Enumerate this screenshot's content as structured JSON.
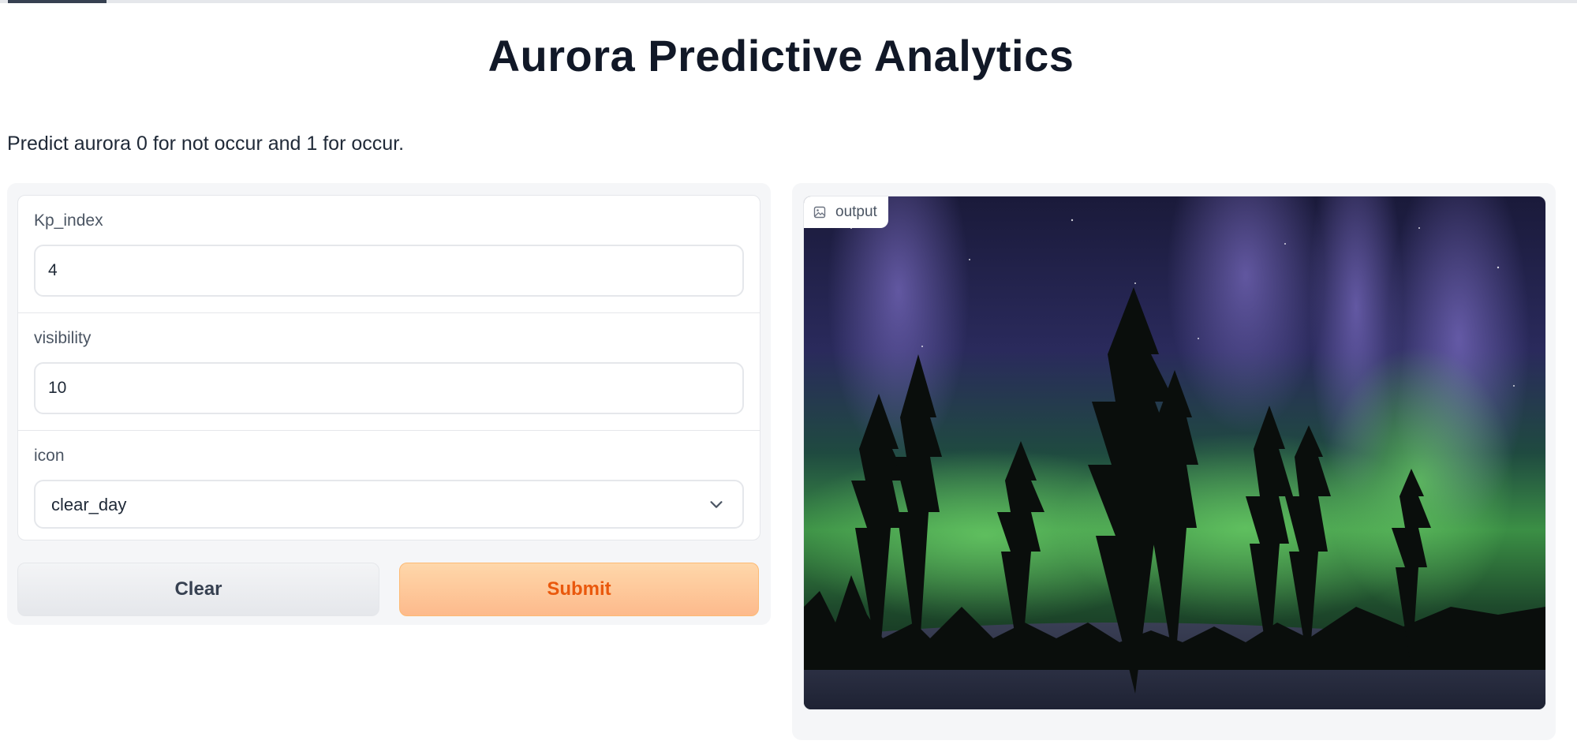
{
  "app": {
    "title": "Aurora Predictive Analytics",
    "description": "Predict aurora 0 for not occur and 1 for occur."
  },
  "inputs": {
    "kp_index": {
      "label": "Kp_index",
      "value": "4"
    },
    "visibility": {
      "label": "visibility",
      "value": "10"
    },
    "icon": {
      "label": "icon",
      "selected": "clear_day"
    }
  },
  "buttons": {
    "clear_label": "Clear",
    "submit_label": "Submit"
  },
  "output": {
    "label": "output",
    "image_icon": "image-icon",
    "image_subject": "aurora-borealis-over-forest"
  },
  "colors": {
    "accent": "#ea580c",
    "submit_bg": "#fdba8c",
    "aurora_green": "#3fae4a",
    "aurora_purple": "#5b4aa0"
  }
}
